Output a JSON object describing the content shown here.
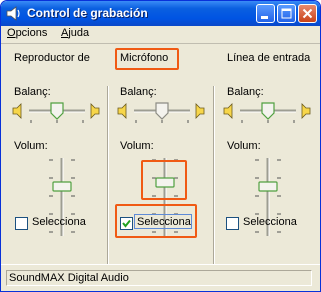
{
  "window": {
    "title": "Control de grabación"
  },
  "menu": {
    "items": [
      {
        "label": "Opcions",
        "key": "O"
      },
      {
        "label": "Ajuda",
        "key": "A"
      }
    ]
  },
  "columns": [
    {
      "title": "Reproductor de",
      "balance_label": "Balanç:",
      "volume_label": "Volum:",
      "select_label": "Selecciona",
      "selected": false,
      "highlighted": false
    },
    {
      "title": "Micrófono",
      "balance_label": "Balanç:",
      "volume_label": "Volum:",
      "select_label": "Selecciona",
      "selected": true,
      "highlighted": true
    },
    {
      "title": "Línea de entrada",
      "balance_label": "Balanç:",
      "volume_label": "Volum:",
      "select_label": "Selecciona",
      "selected": false,
      "highlighted": false
    }
  ],
  "status": {
    "text": "SoundMAX Digital Audio"
  },
  "colors": {
    "titlebar": "#0054e3",
    "highlight": "#f05a14",
    "window_bg": "#ece9d8",
    "check": "#21a121"
  },
  "icons": {
    "app": "speaker-icon",
    "left_channel": "speaker-left-icon",
    "right_channel": "speaker-right-icon"
  }
}
